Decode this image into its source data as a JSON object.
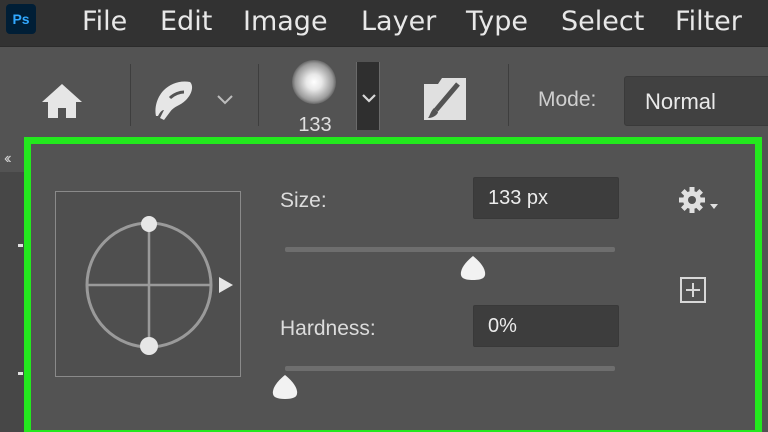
{
  "app": {
    "logo_text": "Ps"
  },
  "menu": [
    {
      "label": "File"
    },
    {
      "label": "Edit"
    },
    {
      "label": "Image"
    },
    {
      "label": "Layer"
    },
    {
      "label": "Type"
    },
    {
      "label": "Select"
    },
    {
      "label": "Filter"
    }
  ],
  "options_bar": {
    "home_icon": "home-icon",
    "tool_icon": "brush-tool-icon",
    "brush_size_label": "133",
    "mode_label": "Mode:",
    "mode_value": "Normal"
  },
  "brush_popup": {
    "size_label": "Size:",
    "size_value": "133 px",
    "size_slider_fraction": 0.57,
    "hardness_label": "Hardness:",
    "hardness_value": "0%",
    "hardness_slider_fraction": 0.0,
    "gear_icon": "gear-icon",
    "add_icon": "add-preset-icon"
  },
  "colors": {
    "menubar_bg": "#323232",
    "panel_bg": "#535353",
    "highlight_border": "#23e81e",
    "field_bg": "#3d3d3d"
  }
}
